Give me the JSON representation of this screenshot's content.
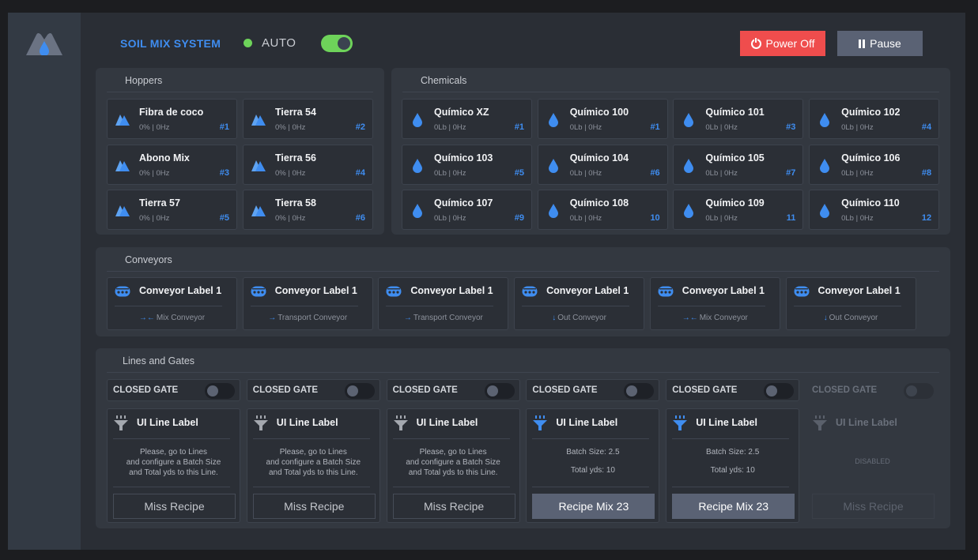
{
  "app": {
    "title": "SOIL MIX SYSTEM",
    "mode_label": "AUTO",
    "mode_on": true
  },
  "actions": {
    "power_label": "Power Off",
    "pause_label": "Pause"
  },
  "colors": {
    "accent": "#3f8df0",
    "danger": "#ef4d4d",
    "ok": "#6ed35a",
    "neutral_button": "#5a6274"
  },
  "hoppers": {
    "title": "Hoppers",
    "icon": "hopper-icon",
    "items": [
      {
        "name": "Fibra de coco",
        "sub": "0% | 0Hz",
        "num": "#1"
      },
      {
        "name": "Tierra 54",
        "sub": "0% | 0Hz",
        "num": "#2"
      },
      {
        "name": "Abono Mix",
        "sub": "0% | 0Hz",
        "num": "#3"
      },
      {
        "name": "Tierra 56",
        "sub": "0% | 0Hz",
        "num": "#4"
      },
      {
        "name": "Tierra 57",
        "sub": "0% | 0Hz",
        "num": "#5"
      },
      {
        "name": "Tierra 58",
        "sub": "0% | 0Hz",
        "num": "#6"
      }
    ]
  },
  "chemicals": {
    "title": "Chemicals",
    "icon": "droplet-icon",
    "items": [
      {
        "name": "Químico XZ",
        "sub": "0Lb | 0Hz",
        "num": "#1"
      },
      {
        "name": "Químico 100",
        "sub": "0Lb | 0Hz",
        "num": "#1"
      },
      {
        "name": "Químico 101",
        "sub": "0Lb | 0Hz",
        "num": "#3"
      },
      {
        "name": "Químico 102",
        "sub": "0Lb | 0Hz",
        "num": "#4"
      },
      {
        "name": "Químico 103",
        "sub": "0Lb | 0Hz",
        "num": "#5"
      },
      {
        "name": "Químico 104",
        "sub": "0Lb | 0Hz",
        "num": "#6"
      },
      {
        "name": "Químico 105",
        "sub": "0Lb | 0Hz",
        "num": "#7"
      },
      {
        "name": "Químico 106",
        "sub": "0Lb | 0Hz",
        "num": "#8"
      },
      {
        "name": "Químico 107",
        "sub": "0Lb | 0Hz",
        "num": "#9"
      },
      {
        "name": "Químico 108",
        "sub": "0Lb | 0Hz",
        "num": "10"
      },
      {
        "name": "Químico 109",
        "sub": "0Lb | 0Hz",
        "num": "11"
      },
      {
        "name": "Químico 110",
        "sub": "0Lb | 0Hz",
        "num": "12"
      }
    ]
  },
  "conveyors": {
    "title": "Conveyors",
    "icon": "conveyor-icon",
    "items": [
      {
        "name": "Conveyor Label 1",
        "arrow": "→←",
        "type": "Mix Conveyor"
      },
      {
        "name": "Conveyor Label 1",
        "arrow": "→",
        "type": "Transport Conveyor"
      },
      {
        "name": "Conveyor Label 1",
        "arrow": "→",
        "type": "Transport Conveyor"
      },
      {
        "name": "Conveyor Label 1",
        "arrow": "↓",
        "type": "Out Conveyor"
      },
      {
        "name": "Conveyor Label 1",
        "arrow": "→←",
        "type": "Mix Conveyor"
      },
      {
        "name": "Conveyor Label 1",
        "arrow": "↓",
        "type": "Out Conveyor"
      }
    ]
  },
  "lines": {
    "title": "Lines and Gates",
    "icon": "funnel-icon",
    "items": [
      {
        "gate": "CLOSED GATE",
        "name": "UI Line Label",
        "msg1": "Please, go to Lines",
        "msg2": "and configure a Batch Size",
        "msg3": "and Total yds to this Line.",
        "button": "Miss Recipe",
        "state": "missing"
      },
      {
        "gate": "CLOSED GATE",
        "name": "UI Line Label",
        "msg1": "Please, go to Lines",
        "msg2": "and configure a Batch Size",
        "msg3": "and Total yds to this Line.",
        "button": "Miss Recipe",
        "state": "missing"
      },
      {
        "gate": "CLOSED GATE",
        "name": "UI Line Label",
        "msg1": "Please, go to Lines",
        "msg2": "and configure a Batch Size",
        "msg3": "and Total yds to this Line.",
        "button": "Miss Recipe",
        "state": "missing"
      },
      {
        "gate": "CLOSED GATE",
        "name": "UI Line Label",
        "batch": "Batch Size: 2.5",
        "total": "Total yds: 10",
        "button": "Recipe Mix 23",
        "state": "active"
      },
      {
        "gate": "CLOSED GATE",
        "name": "UI Line Label",
        "batch": "Batch Size: 2.5",
        "total": "Total yds: 10",
        "button": "Recipe Mix 23",
        "state": "active"
      },
      {
        "gate": "CLOSED GATE",
        "name": "UI Line Label",
        "msg1": "DISABLED",
        "button": "Miss Recipe",
        "state": "disabled"
      }
    ]
  }
}
